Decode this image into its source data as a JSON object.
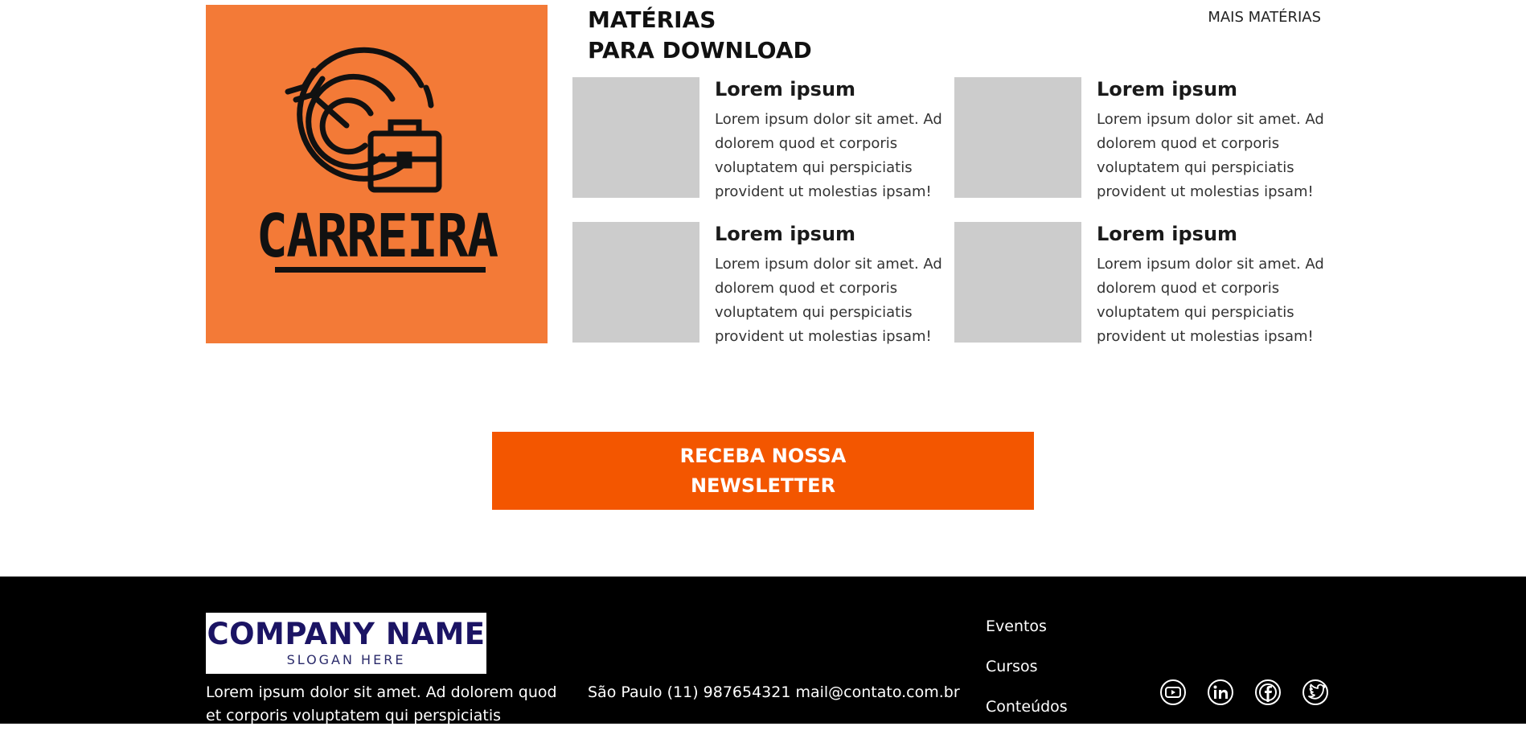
{
  "hero": {
    "label": "CARREIRA",
    "background": "#f37a37",
    "icon": "target-briefcase-icon"
  },
  "section": {
    "title_line1": "MATÉRIAS",
    "title_line2": "PARA DOWNLOAD",
    "more_link": "MAIS MATÉRIAS"
  },
  "cards": [
    {
      "title": "Lorem ipsum",
      "text": "Lorem ipsum dolor sit amet. Ad dolorem quod et corporis voluptatem qui perspiciatis provident ut molestias ipsam!"
    },
    {
      "title": "Lorem ipsum",
      "text": "Lorem ipsum dolor sit amet. Ad dolorem quod et corporis voluptatem qui perspiciatis provident ut molestias ipsam!"
    },
    {
      "title": "Lorem ipsum",
      "text": "Lorem ipsum dolor sit amet. Ad dolorem quod et corporis voluptatem qui perspiciatis provident ut molestias ipsam!"
    },
    {
      "title": "Lorem ipsum",
      "text": "Lorem ipsum dolor sit amet. Ad dolorem quod et corporis voluptatem qui perspiciatis provident ut molestias ipsam!"
    }
  ],
  "newsletter": {
    "line1": "RECEBA NOSSA",
    "line2": "NEWSLETTER",
    "color": "#f35600"
  },
  "footer": {
    "logo_name": "COMPANY NAME",
    "logo_slogan": "SLOGAN HERE",
    "text": "Lorem ipsum dolor sit amet. Ad dolorem quod et corporis voluptatem qui perspiciatis provident ut",
    "contact": "São Paulo (11) 987654321 mail@contato.com.br",
    "nav": [
      "Eventos",
      "Cursos",
      "Conteúdos"
    ],
    "social_icons": [
      "youtube-icon",
      "linkedin-icon",
      "facebook-icon",
      "twitter-icon"
    ]
  }
}
